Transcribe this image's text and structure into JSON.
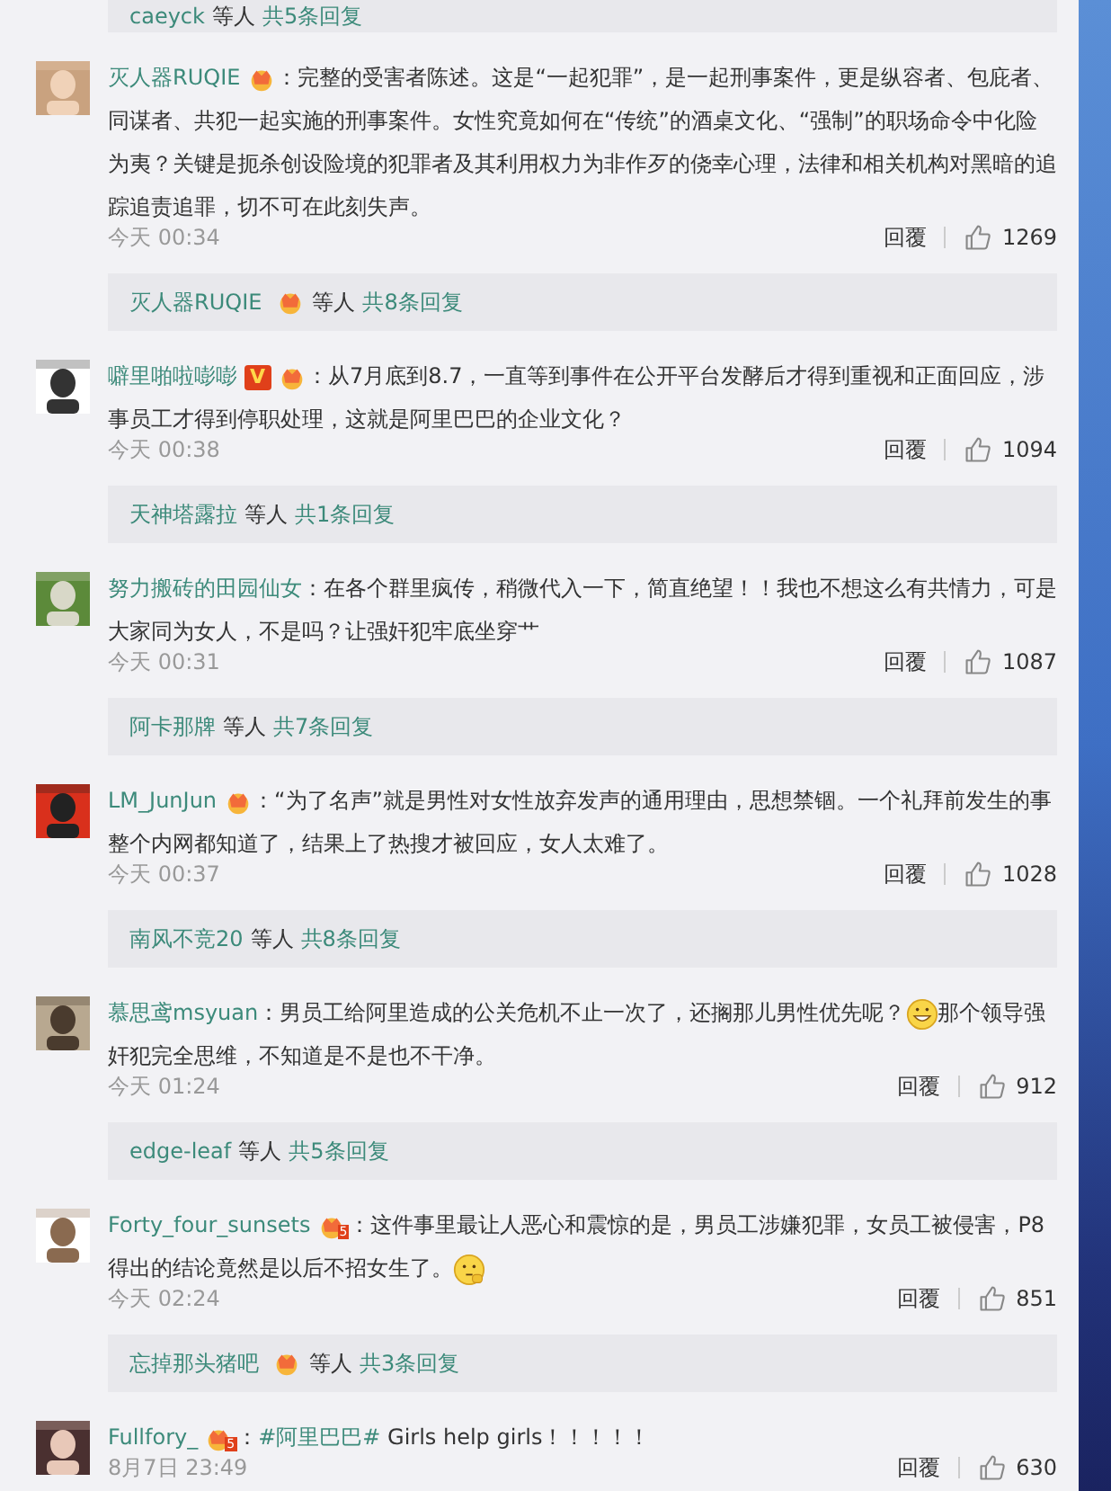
{
  "top_reply_bar": {
    "user": "caeyck",
    "suffix": "等人",
    "count": "共5条回复"
  },
  "comments": [
    {
      "user": "灭人器RUQIE",
      "badges": [
        {
          "kind": "crown"
        }
      ],
      "segments": [
        {
          "kind": "text",
          "text": "：完整的受害者陈述。这是“一起犯罪”，是一起刑事案件，更是纵容者、包庇者、同谋者、共犯一起实施的刑事案件。女性究竟如何在“传统”的酒桌文化、“强制”的职场命令中化险为夷？关键是扼杀创设险境的犯罪者及其利用权力为非作歹的侥幸心理，法律和相关机构对黑暗的追踪追责追罪，切不可在此刻失声。"
        }
      ],
      "time": "今天 00:34",
      "reply_label": "回覆",
      "likes": "1269",
      "replies": {
        "user": "灭人器RUQIE",
        "badges": [
          {
            "kind": "crown"
          }
        ],
        "suffix": "等人",
        "count": "共8条回复"
      }
    },
    {
      "user": "噼里啪啦嘭嘭",
      "badges": [
        {
          "kind": "verified",
          "text": "V"
        },
        {
          "kind": "crown"
        }
      ],
      "segments": [
        {
          "kind": "text",
          "text": "：从7月底到8.7，一直等到事件在公开平台发酵后才得到重视和正面回应，涉事员工才得到停职处理，这就是阿里巴巴的企业文化？"
        }
      ],
      "time": "今天 00:38",
      "reply_label": "回覆",
      "likes": "1094",
      "replies": {
        "user": "天神塔露拉",
        "suffix": "等人",
        "count": "共1条回复"
      }
    },
    {
      "user": "努力搬砖的田园仙女",
      "segments": [
        {
          "kind": "text",
          "text": "：在各个群里疯传，稍微代入一下，简直绝望！！我也不想这么有共情力，可是大家同为女人，不是吗？让强奸犯牢底坐穿艹"
        }
      ],
      "time": "今天 00:31",
      "reply_label": "回覆",
      "likes": "1087",
      "replies": {
        "user": "阿卡那牌",
        "suffix": "等人",
        "count": "共7条回复"
      }
    },
    {
      "user": "LM_JunJun",
      "badges": [
        {
          "kind": "crown"
        }
      ],
      "segments": [
        {
          "kind": "text",
          "text": "：“为了名声”就是男性对女性放弃发声的通用理由，思想禁锢。一个礼拜前发生的事整个内网都知道了，结果上了热搜才被回应，女人太难了。"
        }
      ],
      "time": "今天 00:37",
      "reply_label": "回覆",
      "likes": "1028",
      "replies": {
        "user": "南风不竞20",
        "suffix": "等人",
        "count": "共8条回复"
      }
    },
    {
      "user": "慕思鸢msyuan",
      "segments": [
        {
          "kind": "text",
          "text": "：男员工给阿里造成的公关危机不止一次了，还搁那儿男性优先呢？"
        },
        {
          "kind": "grin_emoji"
        },
        {
          "kind": "text",
          "text": "那个领导强奸犯完全思维，不知道是不是也不干净。"
        }
      ],
      "time": "今天 01:24",
      "reply_label": "回覆",
      "likes": "912",
      "replies": {
        "user": "edge-leaf",
        "suffix": "等人",
        "count": "共5条回复"
      }
    },
    {
      "user": "Forty_four_sunsets",
      "badges": [
        {
          "kind": "crown",
          "tag": "5"
        }
      ],
      "segments": [
        {
          "kind": "text",
          "text": "：这件事里最让人恶心和震惊的是，男员工涉嫌犯罪，女员工被侵害，P8得出的结论竟然是以后不招女生了。"
        },
        {
          "kind": "think_emoji"
        }
      ],
      "time": "今天 02:24",
      "reply_label": "回覆",
      "likes": "851",
      "replies": {
        "user": "忘掉那头猪吧",
        "badges": [
          {
            "kind": "crown"
          }
        ],
        "suffix": "等人",
        "count": "共3条回复"
      }
    },
    {
      "user": "Fullfory_",
      "badges": [
        {
          "kind": "crown",
          "tag": "5"
        }
      ],
      "segments": [
        {
          "kind": "text",
          "text": "："
        },
        {
          "kind": "hashtag",
          "text": "#阿里巴巴#"
        },
        {
          "kind": "text",
          "text": " Girls help girls！！！！！"
        }
      ],
      "time": "8月7日 23:49",
      "reply_label": "回覆",
      "likes": "630"
    }
  ]
}
